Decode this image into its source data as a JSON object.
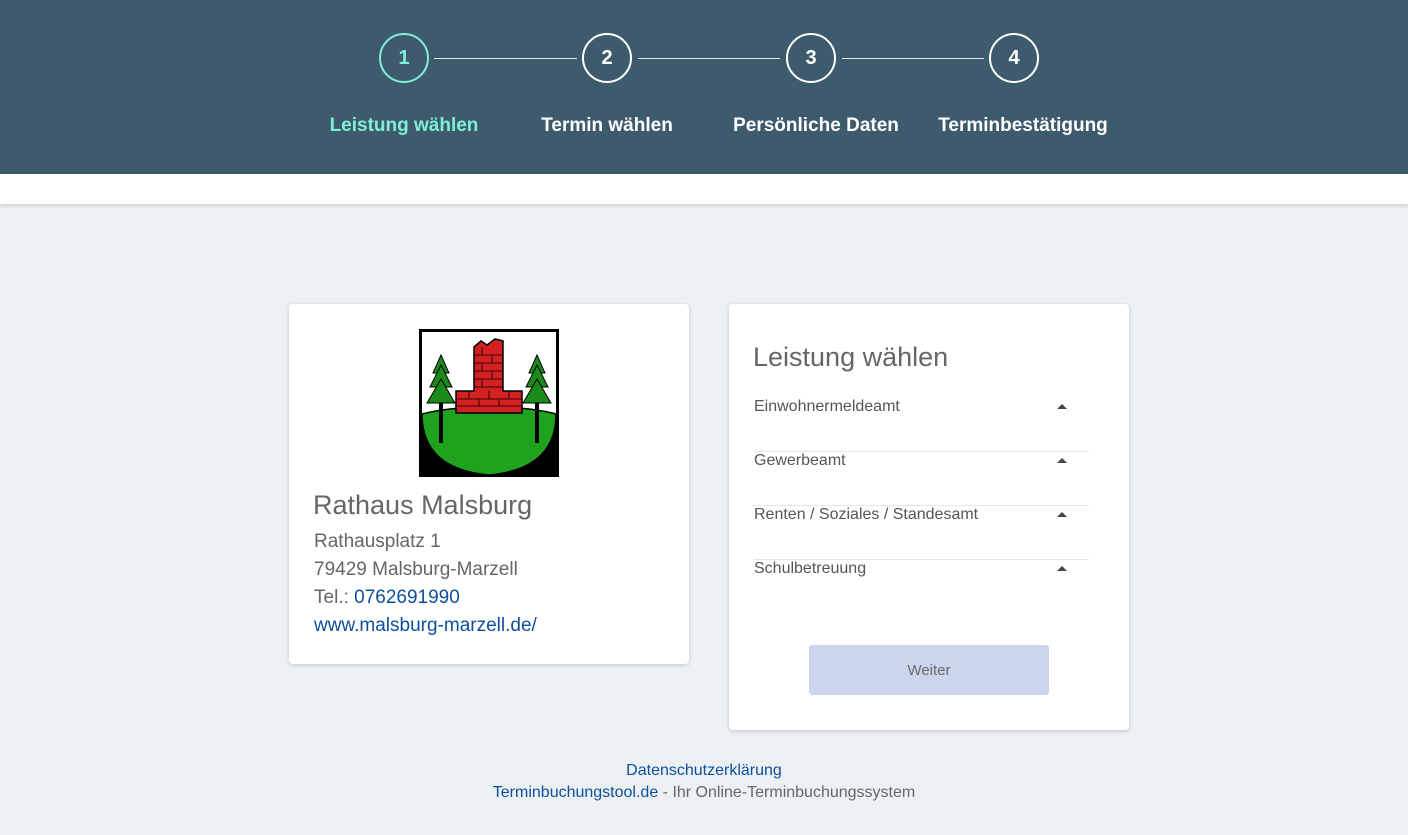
{
  "steps": [
    {
      "number": "1",
      "label": "Leistung wählen",
      "active": true
    },
    {
      "number": "2",
      "label": "Termin wählen",
      "active": false
    },
    {
      "number": "3",
      "label": "Persönliche Daten",
      "active": false
    },
    {
      "number": "4",
      "label": "Terminbestätigung",
      "active": false
    }
  ],
  "office": {
    "crest_icon": "malsburg-coat-of-arms",
    "name": "Rathaus Malsburg",
    "street": "Rathausplatz 1",
    "city": "79429 Malsburg-Marzell",
    "phone_prefix": "Tel.: ",
    "phone": "0762691990",
    "website": "www.malsburg-marzell.de/"
  },
  "services": {
    "title": "Leistung wählen",
    "items": [
      {
        "label": "Einwohnermeldeamt",
        "icon": "caret-up-icon"
      },
      {
        "label": "Gewerbeamt",
        "icon": "caret-up-icon"
      },
      {
        "label": "Renten / Soziales / Standesamt",
        "icon": "caret-up-icon"
      },
      {
        "label": "Schulbetreuung",
        "icon": "caret-up-icon"
      }
    ],
    "next_button": "Weiter"
  },
  "footer": {
    "privacy": "Datenschutzerklärung",
    "tool_link": "Terminbuchungstool.de",
    "tool_suffix": " - Ihr Online-Terminbuchungssystem"
  },
  "colors": {
    "header": "#3e5a6d",
    "active_step": "#7ff0d8",
    "link": "#0d4f9c",
    "button_disabled": "#cbd5ec",
    "background": "#edf0f3"
  }
}
